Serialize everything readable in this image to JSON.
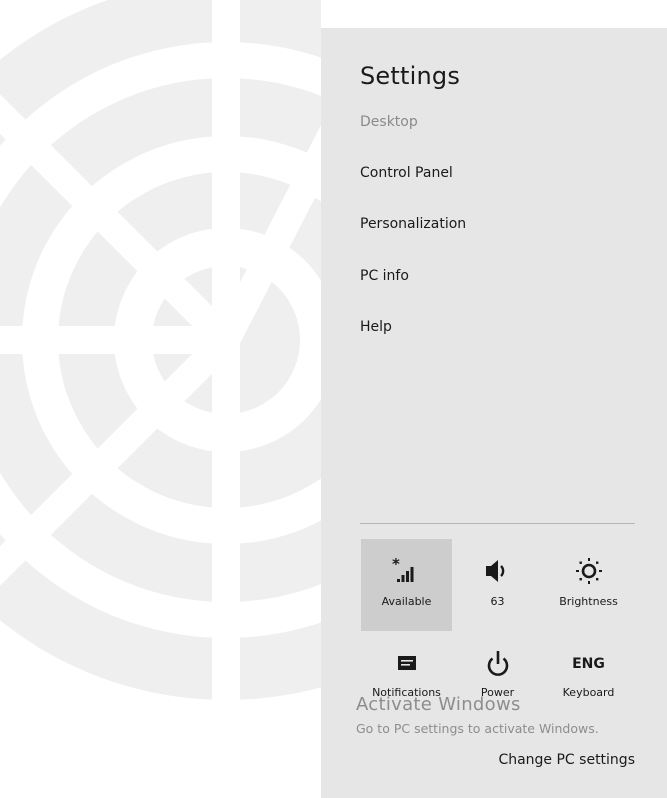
{
  "settings_pane": {
    "title": "Settings",
    "subtitle": "Desktop",
    "links": [
      "Control Panel",
      "Personalization",
      "PC info",
      "Help"
    ]
  },
  "quick_settings": {
    "tiles": [
      {
        "label": "Available",
        "icon": "network-signal-icon",
        "selected": true
      },
      {
        "label": "63",
        "icon": "volume-icon",
        "selected": false
      },
      {
        "label": "Brightness",
        "icon": "brightness-icon",
        "selected": false
      },
      {
        "label": "Notifications",
        "icon": "notifications-icon",
        "selected": false
      },
      {
        "label": "Power",
        "icon": "power-icon",
        "selected": false
      },
      {
        "label": "Keyboard",
        "icon": "keyboard-icon",
        "icon_text": "ENG",
        "selected": false
      }
    ],
    "footer_link": "Change PC settings"
  },
  "watermark": {
    "title": "Activate Windows",
    "subtitle": "Go to PC settings to activate Windows."
  },
  "colors": {
    "pane_background": "#e6e6e6",
    "selected_tile": "#cdcdcd",
    "wallpaper_background": "#ffffff",
    "wallpaper_shape": "#efefef",
    "text_primary": "#1a1a1a",
    "text_muted": "#8a8a8a"
  }
}
